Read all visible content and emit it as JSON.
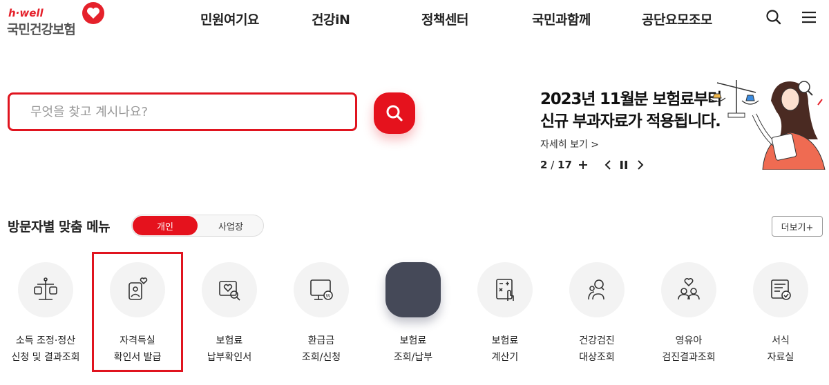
{
  "header": {
    "logo_small": "h·well",
    "logo_name": "국민건강보험",
    "nav": [
      "민원여기요",
      "건강iN",
      "정책센터",
      "국민과함께",
      "공단요모조모"
    ],
    "icons": [
      "search-icon",
      "menu-icon"
    ]
  },
  "search": {
    "placeholder": "무엇을 찾고 계시나요?",
    "value": ""
  },
  "banner": {
    "title_line1": "2023년 11월분 보험료부터",
    "title_line2": "신규 부과자료가 적용됩니다.",
    "more_link": "자세히 보기 >",
    "page_current": "2",
    "page_sep": " / ",
    "page_total": "17"
  },
  "menu_section": {
    "title": "방문자별 맞춤 메뉴",
    "tab_personal": "개인",
    "tab_business": "사업장",
    "more_button": "더보기+",
    "items": [
      {
        "line1": "소득 조정·정산",
        "line2": "신청 및 결과조회",
        "icon": "scale-icon"
      },
      {
        "line1": "자격득실",
        "line2": "확인서 발급",
        "icon": "id-card-heart-icon"
      },
      {
        "line1": "보험료",
        "line2": "납부확인서",
        "icon": "document-search-icon"
      },
      {
        "line1": "환급금",
        "line2": "조회/신청",
        "icon": "monitor-won-icon"
      },
      {
        "line1": "보험료",
        "line2": "조회/납부",
        "icon": "blank-icon"
      },
      {
        "line1": "보험료",
        "line2": "계산기",
        "icon": "calculator-icon"
      },
      {
        "line1": "건강검진",
        "line2": "대상조회",
        "icon": "people-search-icon"
      },
      {
        "line1": "영유아",
        "line2": "검진결과조회",
        "icon": "family-heart-icon"
      },
      {
        "line1": "서식",
        "line2": "자료실",
        "icon": "form-check-icon"
      }
    ]
  },
  "colors": {
    "accent": "#e5121d",
    "dark_tile": "#454958"
  }
}
